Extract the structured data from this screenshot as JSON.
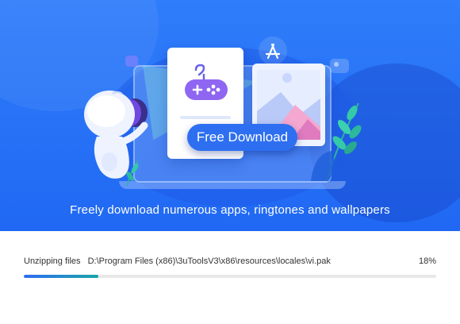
{
  "banner": {
    "cta_label": "Free Download",
    "tagline": "Freely download numerous apps, ringtones and wallpapers",
    "colors": {
      "background": "#2068f3",
      "button": "#2d6ff0",
      "game_pad": "#8f66f2",
      "leaf": "#34c9a8"
    },
    "icons": [
      "robot-mascot",
      "gamepad-icon",
      "music-note-icon",
      "app-store-icon",
      "picture-icon",
      "leaf-icon"
    ]
  },
  "progress": {
    "label": "Unzipping files",
    "path": "D:\\Program Files (x86)\\3uToolsV3\\x86\\resources\\locales\\vi.pak",
    "percent_text": "18%",
    "percent": 0.18,
    "colors": {
      "track": "#e8e8e8",
      "fill_start": "#2f6df0",
      "fill_end": "#19a6a8"
    }
  }
}
